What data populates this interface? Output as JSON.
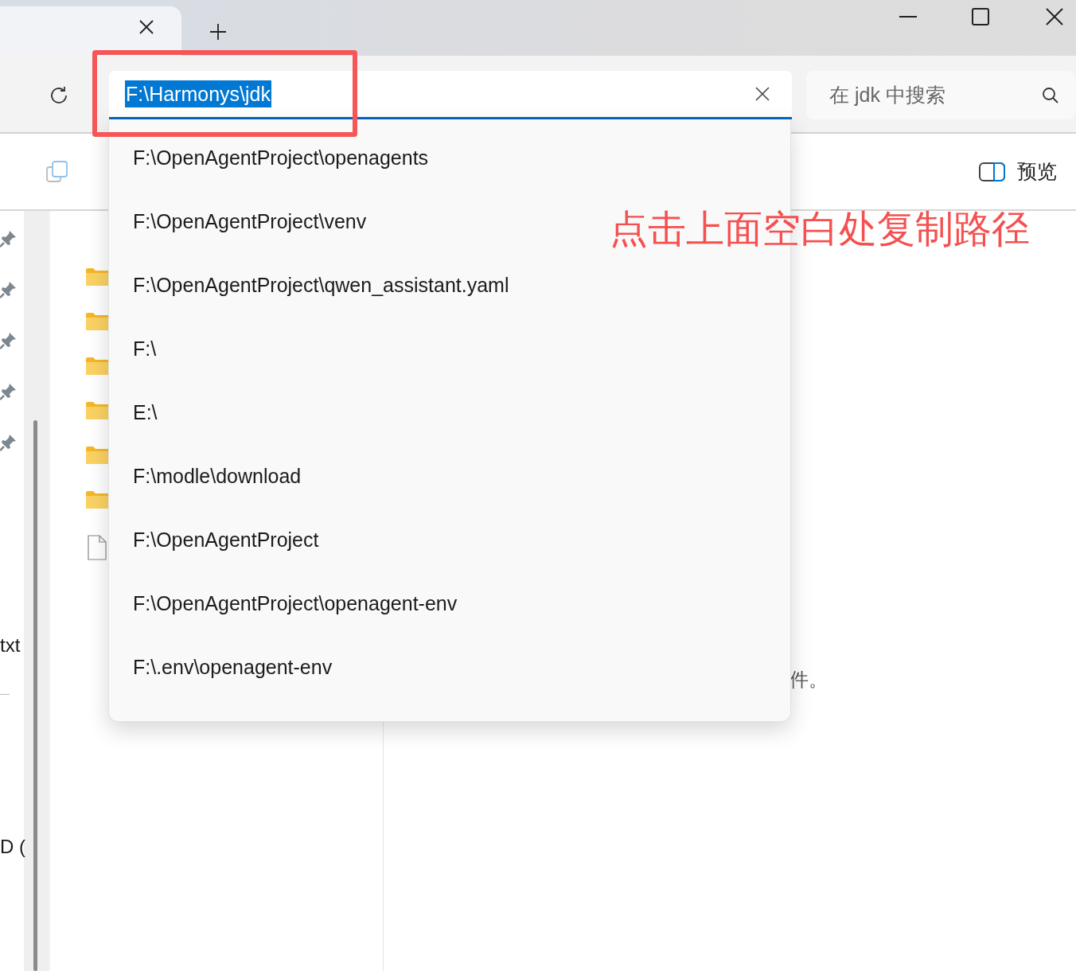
{
  "address_bar": {
    "value": "F:\\Harmonys\\jdk",
    "selected": true
  },
  "search": {
    "placeholder": "在 jdk 中搜索"
  },
  "toolbar": {
    "preview": "预览"
  },
  "suggestions": [
    "F:\\OpenAgentProject\\openagents",
    "F:\\OpenAgentProject\\venv",
    "F:\\OpenAgentProject\\qwen_assistant.yaml",
    "F:\\",
    "E:\\",
    "F:\\modle\\download",
    "F:\\OpenAgentProject",
    "F:\\OpenAgentProject\\openagent-env",
    "F:\\.env\\openagent-env"
  ],
  "navigation": {
    "pins": [
      {
        "pinned": true
      },
      {
        "pinned": true
      },
      {
        "pinned": true
      },
      {
        "pinned": true
      },
      {
        "pinned": true
      }
    ],
    "labels": [
      "txt",
      "D ("
    ]
  },
  "files": [
    {
      "kind": "folder"
    },
    {
      "kind": "folder"
    },
    {
      "kind": "folder"
    },
    {
      "kind": "folder"
    },
    {
      "kind": "folder"
    },
    {
      "kind": "folder"
    },
    {
      "kind": "file"
    }
  ],
  "details_text": "件。",
  "annotation": {
    "text": "点击上面空白处复制路径"
  }
}
